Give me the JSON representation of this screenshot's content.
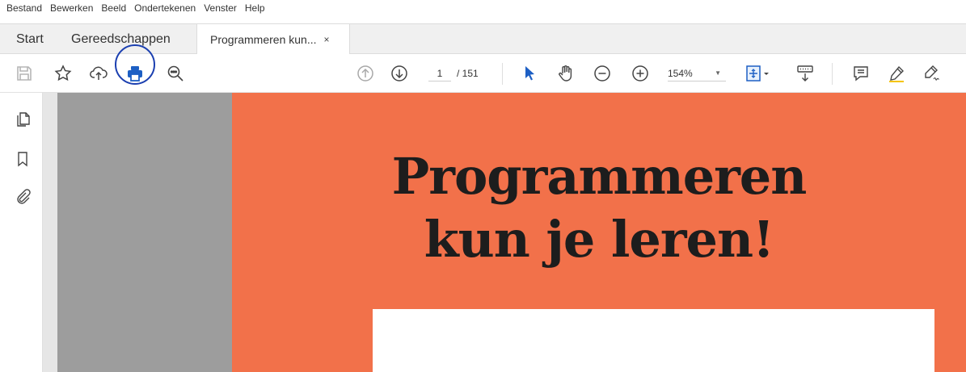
{
  "menu": [
    "Bestand",
    "Bewerken",
    "Beeld",
    "Ondertekenen",
    "Venster",
    "Help"
  ],
  "tabs": {
    "start": "Start",
    "tools": "Gereedschappen",
    "document": "Programmeren kun...",
    "document_close": "×"
  },
  "toolbar": {
    "page_current": "1",
    "page_total": "/ 151",
    "zoom": "154%",
    "zoom_caret": "▼",
    "highlighted_tool": "print",
    "highlight_color": "#1b3fb0"
  },
  "sidebar_icons": [
    "pages-icon",
    "bookmark-icon",
    "attachment-icon"
  ],
  "document": {
    "title_line1": "Programmeren",
    "title_line2": "kun je leren!",
    "background_color": "#f2714a"
  }
}
